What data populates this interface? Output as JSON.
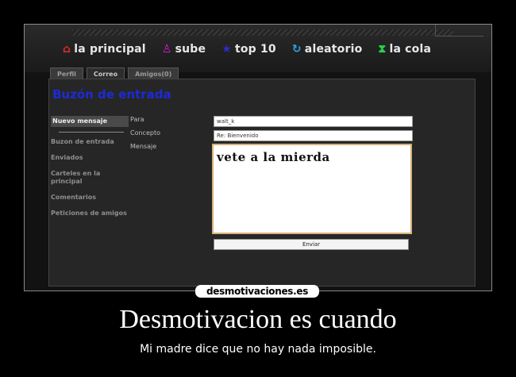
{
  "nav": {
    "items": [
      {
        "label": "la principal",
        "icon": "home-icon",
        "glyph": "⌂"
      },
      {
        "label": "sube",
        "icon": "person-icon",
        "glyph": "♙"
      },
      {
        "label": "top 10",
        "icon": "star-icon",
        "glyph": "★"
      },
      {
        "label": "aleatorio",
        "icon": "refresh-icon",
        "glyph": "↻"
      },
      {
        "label": "la cola",
        "icon": "hourglass-icon",
        "glyph": "⧗"
      }
    ]
  },
  "tabs": [
    {
      "label": "Perfil"
    },
    {
      "label": "Correo"
    },
    {
      "label": "Amigos(0)"
    }
  ],
  "panel": {
    "title": "Buzón de entrada"
  },
  "sidebar": {
    "items": [
      {
        "label": "Nuevo mensaje"
      },
      {
        "label": "Buzon de entrada"
      },
      {
        "label": "Enviados"
      },
      {
        "label": "Carteles en la principal"
      },
      {
        "label": "Comentarios"
      },
      {
        "label": "Peticiones de amigos"
      }
    ]
  },
  "form": {
    "labels": {
      "to": "Para",
      "subject": "Concepto",
      "message": "Mensaje"
    },
    "to_value": "walt_k",
    "subject_value": "Re: Bienvenido",
    "message_value": "vete a la mierda",
    "send_label": "Enviar"
  },
  "poster": {
    "watermark": "desmotivaciones.es",
    "title": "Desmotivacion es cuando",
    "subtitle": "Mi madre dice que no hay nada imposible."
  }
}
